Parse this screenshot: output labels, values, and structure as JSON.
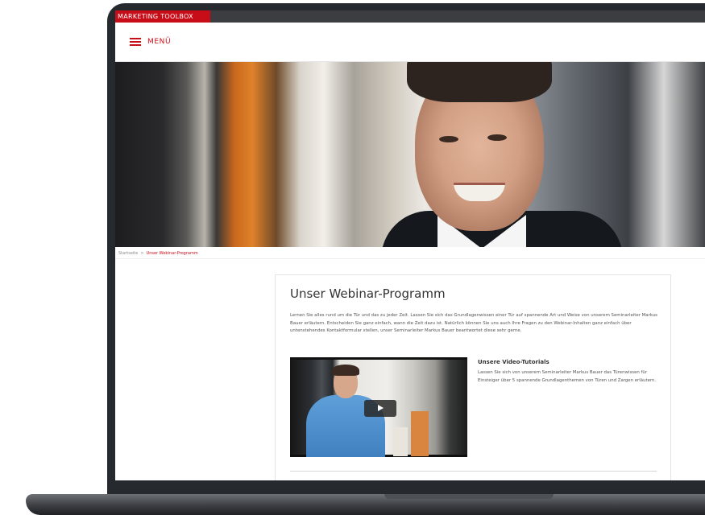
{
  "topbar": {
    "brand": "MARKETING TOOLBOX"
  },
  "header": {
    "menu_label": "MENÜ"
  },
  "breadcrumb": {
    "home": "Startseite",
    "separator": ">",
    "current": "Unser Webinar-Programm"
  },
  "main": {
    "title": "Unser Webinar-Programm",
    "intro": "Lernen Sie alles rund um die Tür und das zu jeder Zeit. Lassen Sie sich das Grundlagenwissen einer Tür auf spannende Art und Weise von unserem Seminarleiter Markus Bauer erläutern. Entscheiden Sie ganz einfach, wann die Zeit dazu ist. Natürlich können Sie uns auch Ihre Fragen zu den Webinar-Inhalten ganz einfach über untenstehendes Kontaktformular stellen, unser Seminarleiter Markus Bauer beantwortet diese sehr gerne.",
    "tutorials": {
      "title": "Unsere Video-Tutorials",
      "text": "Lassen Sie sich von unserem Seminarleiter Markus Bauer das Türenwissen für Einsteiger über 5 spannende Grundlagenthemen von Türen und Zargen erläutern."
    }
  },
  "colors": {
    "accent": "#c80d19",
    "topbar": "#3b3d40",
    "bezel": "#26292d"
  },
  "icons": {
    "menu": "hamburger-icon",
    "play": "play-icon"
  }
}
